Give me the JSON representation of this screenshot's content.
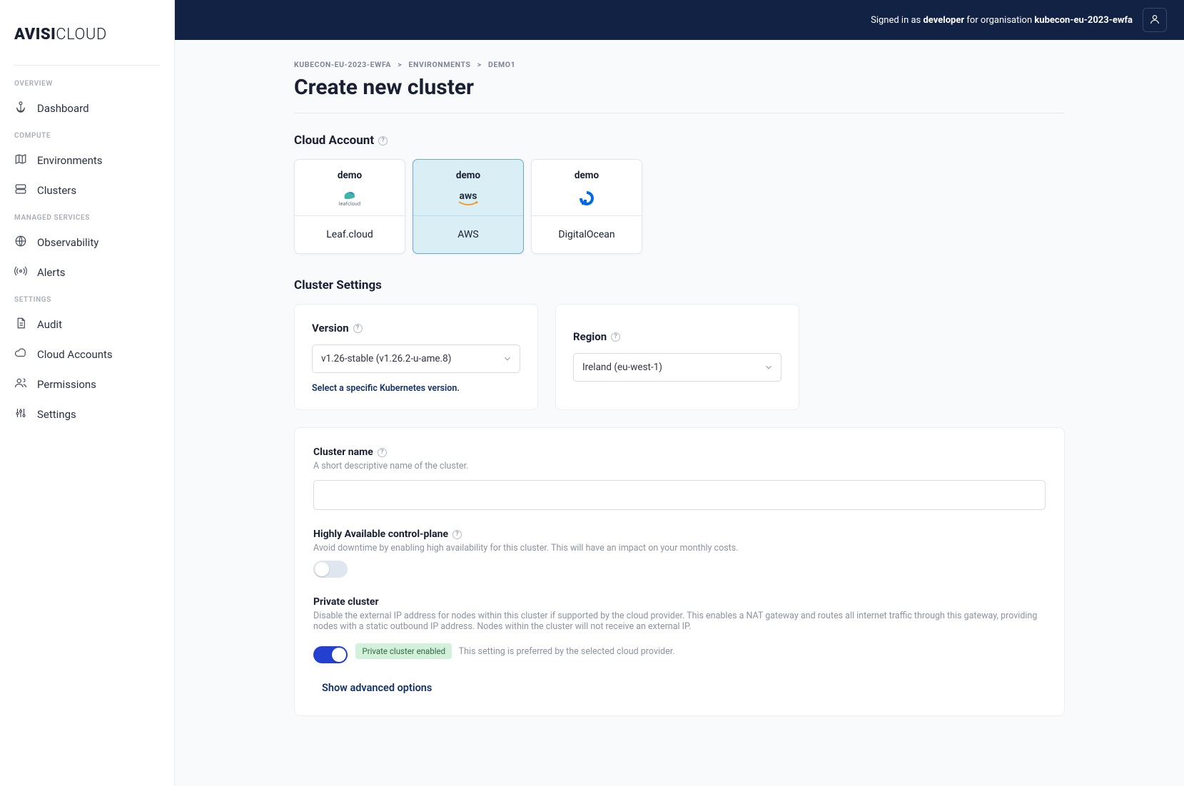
{
  "logo": {
    "bold": "AVISI",
    "light": "CLOUD"
  },
  "sidebar": {
    "groups": {
      "overview": "OVERVIEW",
      "compute": "COMPUTE",
      "managed": "MANAGED SERVICES",
      "settings": "SETTINGS"
    },
    "items": {
      "dashboard": "Dashboard",
      "environments": "Environments",
      "clusters": "Clusters",
      "observability": "Observability",
      "alerts": "Alerts",
      "audit": "Audit",
      "cloud_accounts": "Cloud Accounts",
      "permissions": "Permissions",
      "settings": "Settings"
    }
  },
  "header": {
    "prefix": "Signed in as ",
    "user": "developer",
    "middle": " for organisation ",
    "org": "kubecon-eu-2023-ewfa"
  },
  "breadcrumb": {
    "a": "KUBECON-EU-2023-EWFA",
    "b": "ENVIRONMENTS",
    "c": "DEMO1"
  },
  "page_title": "Create new cluster",
  "cloud_account": {
    "title": "Cloud Account",
    "cards": [
      {
        "name": "demo",
        "provider": "Leaf.cloud"
      },
      {
        "name": "demo",
        "provider": "AWS"
      },
      {
        "name": "demo",
        "provider": "DigitalOcean"
      }
    ]
  },
  "cluster_settings": {
    "title": "Cluster Settings",
    "version_label": "Version",
    "version_value": "v1.26-stable (v1.26.2-u-ame.8)",
    "version_link": "Select a specific Kubernetes version.",
    "region_label": "Region",
    "region_value": "Ireland (eu-west-1)"
  },
  "form": {
    "cluster_name_label": "Cluster name",
    "cluster_name_desc": "A short descriptive name of the cluster.",
    "ha_label": "Highly Available control-plane",
    "ha_desc": "Avoid downtime by enabling high availability for this cluster. This will have an impact on your monthly costs.",
    "private_label": "Private cluster",
    "private_desc": "Disable the external IP address for nodes within this cluster if supported by the cloud provider. This enables a NAT gateway and routes all internet traffic through this gateway, providing nodes with a static outbound IP address. Nodes within the cluster will not receive an external IP.",
    "private_badge": "Private cluster enabled",
    "private_pref": "This setting is preferred by the selected cloud provider.",
    "advanced": "Show advanced options"
  }
}
